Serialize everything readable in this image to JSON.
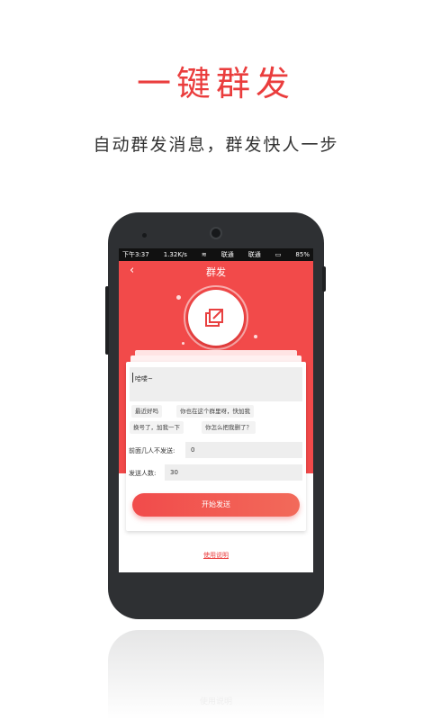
{
  "promo": {
    "headline": "一键群发",
    "subline": "自动群发消息，群发快人一步"
  },
  "statusbar": {
    "time": "下午3:37",
    "speed": "1.32K/s",
    "carrier1": "联通",
    "carrier2": "联通",
    "battery": "85%"
  },
  "header": {
    "back_icon": "‹",
    "title": "群发"
  },
  "message": {
    "value": "哈喽~"
  },
  "quick_phrases": [
    "最近好吗",
    "你也在这个群里呀，快加我",
    "换号了，加我一下",
    "你怎么把我删了？"
  ],
  "fields": {
    "skip_label": "前面几人不发送:",
    "skip_value": "0",
    "count_label": "发送人数:",
    "count_value": "30"
  },
  "actions": {
    "send_label": "开始发送",
    "help_label": "使用说明"
  },
  "reflection": {
    "text": "使用说明"
  },
  "colors": {
    "accent": "#f24a4a"
  }
}
